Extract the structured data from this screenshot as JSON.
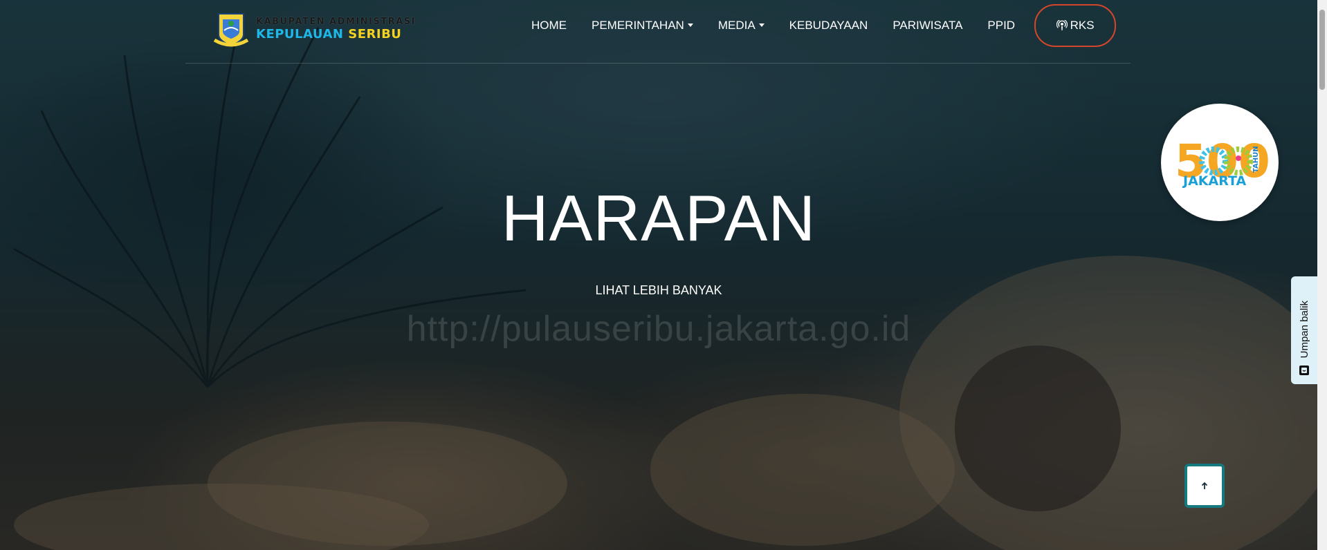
{
  "logo": {
    "line1": "KABUPATEN ADMINISTRASI",
    "line2_part1": "KEPULAUAN",
    "line2_part2": "SERIBU"
  },
  "nav": {
    "items": [
      {
        "label": "HOME",
        "dropdown": false
      },
      {
        "label": "PEMERINTAHAN",
        "dropdown": true
      },
      {
        "label": "MEDIA",
        "dropdown": true
      },
      {
        "label": "KEBUDAYAAN",
        "dropdown": false
      },
      {
        "label": "PARIWISATA",
        "dropdown": false
      },
      {
        "label": "PPID",
        "dropdown": false
      }
    ],
    "rks_label": "RKS",
    "rks_icon": "podcast-icon",
    "rks_border_color": "#d5462a"
  },
  "hero": {
    "title": "HARAPAN",
    "link": "LIHAT LEBIH BANYAK",
    "watermark": "http://pulauseribu.jakarta.go.id"
  },
  "badge": {
    "number": "500",
    "tahun": "TAHUN",
    "city": "JAKARTA"
  },
  "feedback": {
    "label": "Umpan balik",
    "icon": "feedback-icon"
  },
  "to_top": {
    "icon": "arrow-up-icon",
    "border_color": "#157a80"
  }
}
